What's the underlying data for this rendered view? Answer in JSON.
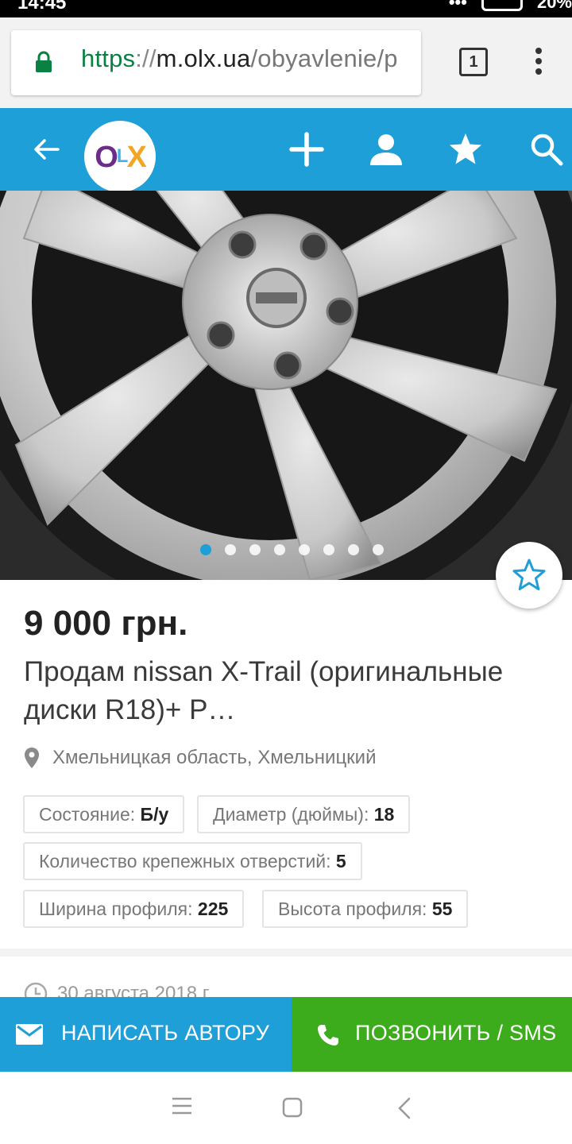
{
  "status_bar": {
    "time": "14:45",
    "battery": "20%"
  },
  "browser": {
    "url_scheme": "https",
    "url_sep": "://",
    "url_host": "m.olx.ua",
    "url_path": "/obyavlenie/p",
    "tab_count": "1"
  },
  "header": {
    "logo_o": "O",
    "logo_l": "L",
    "logo_x": "X",
    "icons": [
      "back-arrow-icon",
      "plus-icon",
      "user-icon",
      "star-icon",
      "search-icon"
    ]
  },
  "gallery": {
    "total_photos": 8,
    "active_index": 0
  },
  "listing": {
    "price": "9 000 грн.",
    "title": "Продам nissan X-Trail (оригинальные диски R18)+ Р…",
    "location": "Хмельницкая область, Хмельницкий",
    "params": [
      {
        "label": "Состояние: ",
        "value": "Б/у"
      },
      {
        "label": "Диаметр (дюймы): ",
        "value": "18"
      },
      {
        "label": "Количество крепежных отверстий: ",
        "value": "5"
      },
      {
        "label": "Ширина профиля: ",
        "value": "225"
      },
      {
        "label": "Высота профиля: ",
        "value": "55"
      }
    ],
    "date": "30 августа 2018 г."
  },
  "actions": {
    "write_label": "НАПИСАТЬ АВТОРУ",
    "call_label": "ПОЗВОНИТЬ / SMS"
  },
  "colors": {
    "olx_blue": "#1f9fd8",
    "call_green": "#3cab1c",
    "secure_green": "#0b8043"
  }
}
